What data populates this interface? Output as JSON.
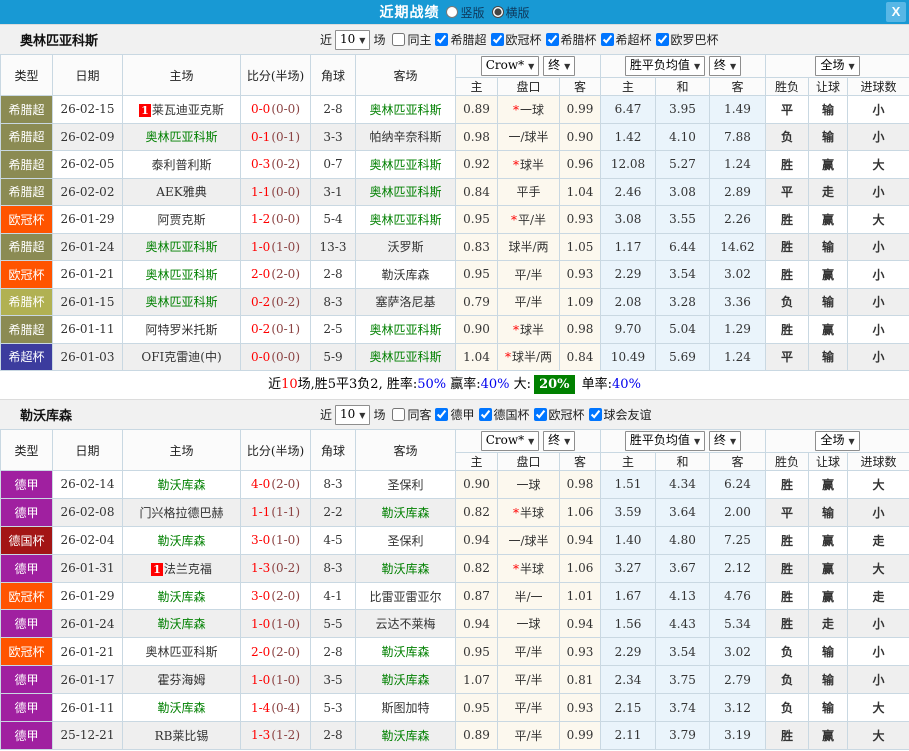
{
  "titlebar": {
    "title": "近期战绩",
    "vertical_label": "竖版",
    "horizontal_label": "横版",
    "selected_layout": "横版",
    "close_label": "X"
  },
  "cols": {
    "type": "类型",
    "date": "日期",
    "home": "主场",
    "score": "比分(半场)",
    "corner": "角球",
    "away": "客场",
    "h": "主",
    "handicap": "盘口",
    "a": "客",
    "avg_h": "主",
    "avg_d": "和",
    "avg_a": "客",
    "result": "胜负",
    "let": "让球",
    "goals": "进球数",
    "sel_crow": "Crow*",
    "sel_final1": "终",
    "sel_avg": "胜平负均值",
    "sel_final2": "终",
    "sel_full": "全场"
  },
  "type_colors": {
    "希腊超": "#8b8b53",
    "欧冠杯": "#ff5400",
    "希腊杯": "#b1b152",
    "希超杯": "#3c3c9e",
    "德甲": "#a020a0",
    "德国杯": "#a31515"
  },
  "accent_colors": {
    "titlebar": "#1899d4",
    "win": "#e60000",
    "loss": "#008000",
    "draw": "#0000e0",
    "summary_highlight": "#008000"
  },
  "sections": [
    {
      "team": "奥林匹亚科斯",
      "near_label": "近",
      "count": "10",
      "matches_label": "场",
      "same_label": "同主",
      "same_checked": false,
      "filters": [
        "希腊超",
        "欧冠杯",
        "希腊杯",
        "希超杯",
        "欧罗巴杯"
      ],
      "rows": [
        {
          "type": "希腊超",
          "date": "26-02-15",
          "badge": "1",
          "home": "莱瓦迪亚克斯",
          "hf": false,
          "ft": "0-0",
          "ht": "(0-0)",
          "corner": "2-8",
          "away": "奥林匹亚科斯",
          "af": true,
          "o1": "0.89",
          "star": true,
          "hcap": "一球",
          "o2": "0.99",
          "m1": "6.47",
          "m2": "3.95",
          "m3": "1.49",
          "res": "平",
          "resc": "b",
          "let": "输",
          "letc": "g",
          "goal": "小",
          "goalc": "g"
        },
        {
          "type": "希腊超",
          "date": "26-02-09",
          "badge": "",
          "home": "奥林匹亚科斯",
          "hf": true,
          "ft": "0-1",
          "ht": "(0-1)",
          "corner": "3-3",
          "away": "帕纳辛奈科斯",
          "af": false,
          "o1": "0.98",
          "star": false,
          "hcap": "一/球半",
          "o2": "0.90",
          "m1": "1.42",
          "m2": "4.10",
          "m3": "7.88",
          "res": "负",
          "resc": "g",
          "let": "输",
          "letc": "g",
          "goal": "小",
          "goalc": "g"
        },
        {
          "type": "希腊超",
          "date": "26-02-05",
          "badge": "",
          "home": "泰利普利斯",
          "hf": false,
          "ft": "0-3",
          "ht": "(0-2)",
          "corner": "0-7",
          "away": "奥林匹亚科斯",
          "af": true,
          "o1": "0.92",
          "star": true,
          "hcap": "球半",
          "o2": "0.96",
          "m1": "12.08",
          "m2": "5.27",
          "m3": "1.24",
          "res": "胜",
          "resc": "r",
          "let": "赢",
          "letc": "r",
          "goal": "大",
          "goalc": "r"
        },
        {
          "type": "希腊超",
          "date": "26-02-02",
          "badge": "",
          "home": "AEK雅典",
          "hf": false,
          "ft": "1-1",
          "ht": "(0-0)",
          "corner": "3-1",
          "away": "奥林匹亚科斯",
          "af": true,
          "o1": "0.84",
          "star": false,
          "hcap": "平手",
          "o2": "1.04",
          "m1": "2.46",
          "m2": "3.08",
          "m3": "2.89",
          "res": "平",
          "resc": "b",
          "let": "走",
          "letc": "b",
          "goal": "小",
          "goalc": "g"
        },
        {
          "type": "欧冠杯",
          "date": "26-01-29",
          "badge": "",
          "home": "阿贾克斯",
          "hf": false,
          "ft": "1-2",
          "ht": "(0-0)",
          "corner": "5-4",
          "away": "奥林匹亚科斯",
          "af": true,
          "o1": "0.95",
          "star": true,
          "hcap": "平/半",
          "o2": "0.93",
          "m1": "3.08",
          "m2": "3.55",
          "m3": "2.26",
          "res": "胜",
          "resc": "r",
          "let": "赢",
          "letc": "r",
          "goal": "大",
          "goalc": "r"
        },
        {
          "type": "希腊超",
          "date": "26-01-24",
          "badge": "",
          "home": "奥林匹亚科斯",
          "hf": true,
          "ft": "1-0",
          "ht": "(1-0)",
          "corner": "13-3",
          "away": "沃罗斯",
          "af": false,
          "o1": "0.83",
          "star": false,
          "hcap": "球半/两",
          "o2": "1.05",
          "m1": "1.17",
          "m2": "6.44",
          "m3": "14.62",
          "res": "胜",
          "resc": "r",
          "let": "输",
          "letc": "g",
          "goal": "小",
          "goalc": "g"
        },
        {
          "type": "欧冠杯",
          "date": "26-01-21",
          "badge": "",
          "home": "奥林匹亚科斯",
          "hf": true,
          "ft": "2-0",
          "ht": "(2-0)",
          "corner": "2-8",
          "away": "勒沃库森",
          "af": false,
          "o1": "0.95",
          "star": false,
          "hcap": "平/半",
          "o2": "0.93",
          "m1": "2.29",
          "m2": "3.54",
          "m3": "3.02",
          "res": "胜",
          "resc": "r",
          "let": "赢",
          "letc": "r",
          "goal": "小",
          "goalc": "g"
        },
        {
          "type": "希腊杯",
          "date": "26-01-15",
          "badge": "",
          "home": "奥林匹亚科斯",
          "hf": true,
          "ft": "0-2",
          "ht": "(0-2)",
          "corner": "8-3",
          "away": "塞萨洛尼基",
          "af": false,
          "o1": "0.79",
          "star": false,
          "hcap": "平/半",
          "o2": "1.09",
          "m1": "2.08",
          "m2": "3.28",
          "m3": "3.36",
          "res": "负",
          "resc": "g",
          "let": "输",
          "letc": "g",
          "goal": "小",
          "goalc": "g"
        },
        {
          "type": "希腊超",
          "date": "26-01-11",
          "badge": "",
          "home": "阿特罗米托斯",
          "hf": false,
          "ft": "0-2",
          "ht": "(0-1)",
          "corner": "2-5",
          "away": "奥林匹亚科斯",
          "af": true,
          "o1": "0.90",
          "star": true,
          "hcap": "球半",
          "o2": "0.98",
          "m1": "9.70",
          "m2": "5.04",
          "m3": "1.29",
          "res": "胜",
          "resc": "r",
          "let": "赢",
          "letc": "r",
          "goal": "小",
          "goalc": "g"
        },
        {
          "type": "希超杯",
          "date": "26-01-03",
          "badge": "",
          "home": "OFI克雷迪(中)",
          "hf": false,
          "ft": "0-0",
          "ht": "(0-0)",
          "corner": "5-9",
          "away": "奥林匹亚科斯",
          "af": true,
          "o1": "1.04",
          "star": true,
          "hcap": "球半/两",
          "o2": "0.84",
          "m1": "10.49",
          "m2": "5.69",
          "m3": "1.24",
          "res": "平",
          "resc": "b",
          "let": "输",
          "letc": "g",
          "goal": "小",
          "goalc": "g"
        }
      ],
      "summary": [
        {
          "t": "近",
          "c": "k"
        },
        {
          "t": "10",
          "c": "r"
        },
        {
          "t": "场,胜5平3负2, 胜率:",
          "c": "k"
        },
        {
          "t": "50%",
          "c": "b"
        },
        {
          "t": " 赢率:",
          "c": "k"
        },
        {
          "t": "40%",
          "c": "b"
        },
        {
          "t": " 大:",
          "c": "k"
        },
        {
          "t": "20%",
          "c": "gbg"
        },
        {
          "t": " 单率:",
          "c": "k"
        },
        {
          "t": "40%",
          "c": "b"
        }
      ]
    },
    {
      "team": "勒沃库森",
      "near_label": "近",
      "count": "10",
      "matches_label": "场",
      "same_label": "同客",
      "same_checked": false,
      "filters": [
        "德甲",
        "德国杯",
        "欧冠杯",
        "球会友谊"
      ],
      "rows": [
        {
          "type": "德甲",
          "date": "26-02-14",
          "badge": "",
          "home": "勒沃库森",
          "hf": true,
          "ft": "4-0",
          "ht": "(2-0)",
          "corner": "8-3",
          "away": "圣保利",
          "af": false,
          "o1": "0.90",
          "star": false,
          "hcap": "一球",
          "o2": "0.98",
          "m1": "1.51",
          "m2": "4.34",
          "m3": "6.24",
          "res": "胜",
          "resc": "r",
          "let": "赢",
          "letc": "r",
          "goal": "大",
          "goalc": "r"
        },
        {
          "type": "德甲",
          "date": "26-02-08",
          "badge": "",
          "home": "门兴格拉德巴赫",
          "hf": false,
          "ft": "1-1",
          "ht": "(1-1)",
          "corner": "2-2",
          "away": "勒沃库森",
          "af": true,
          "o1": "0.82",
          "star": true,
          "hcap": "半球",
          "o2": "1.06",
          "m1": "3.59",
          "m2": "3.64",
          "m3": "2.00",
          "res": "平",
          "resc": "b",
          "let": "输",
          "letc": "g",
          "goal": "小",
          "goalc": "g"
        },
        {
          "type": "德国杯",
          "date": "26-02-04",
          "badge": "",
          "home": "勒沃库森",
          "hf": true,
          "ft": "3-0",
          "ht": "(1-0)",
          "corner": "4-5",
          "away": "圣保利",
          "af": false,
          "o1": "0.94",
          "star": false,
          "hcap": "一/球半",
          "o2": "0.94",
          "m1": "1.40",
          "m2": "4.80",
          "m3": "7.25",
          "res": "胜",
          "resc": "r",
          "let": "赢",
          "letc": "r",
          "goal": "走",
          "goalc": "b"
        },
        {
          "type": "德甲",
          "date": "26-01-31",
          "badge": "1",
          "home": "法兰克福",
          "hf": false,
          "ft": "1-3",
          "ht": "(0-2)",
          "corner": "8-3",
          "away": "勒沃库森",
          "af": true,
          "o1": "0.82",
          "star": true,
          "hcap": "半球",
          "o2": "1.06",
          "m1": "3.27",
          "m2": "3.67",
          "m3": "2.12",
          "res": "胜",
          "resc": "r",
          "let": "赢",
          "letc": "r",
          "goal": "大",
          "goalc": "r"
        },
        {
          "type": "欧冠杯",
          "date": "26-01-29",
          "badge": "",
          "home": "勒沃库森",
          "hf": true,
          "ft": "3-0",
          "ht": "(2-0)",
          "corner": "4-1",
          "away": "比雷亚雷亚尔",
          "af": false,
          "o1": "0.87",
          "star": false,
          "hcap": "半/一",
          "o2": "1.01",
          "m1": "1.67",
          "m2": "4.13",
          "m3": "4.76",
          "res": "胜",
          "resc": "r",
          "let": "赢",
          "letc": "r",
          "goal": "走",
          "goalc": "b"
        },
        {
          "type": "德甲",
          "date": "26-01-24",
          "badge": "",
          "home": "勒沃库森",
          "hf": true,
          "ft": "1-0",
          "ht": "(1-0)",
          "corner": "5-5",
          "away": "云达不莱梅",
          "af": false,
          "o1": "0.94",
          "star": false,
          "hcap": "一球",
          "o2": "0.94",
          "m1": "1.56",
          "m2": "4.43",
          "m3": "5.34",
          "res": "胜",
          "resc": "r",
          "let": "走",
          "letc": "b",
          "goal": "小",
          "goalc": "g"
        },
        {
          "type": "欧冠杯",
          "date": "26-01-21",
          "badge": "",
          "home": "奥林匹亚科斯",
          "hf": false,
          "ft": "2-0",
          "ht": "(2-0)",
          "corner": "2-8",
          "away": "勒沃库森",
          "af": true,
          "o1": "0.95",
          "star": false,
          "hcap": "平/半",
          "o2": "0.93",
          "m1": "2.29",
          "m2": "3.54",
          "m3": "3.02",
          "res": "负",
          "resc": "g",
          "let": "输",
          "letc": "g",
          "goal": "小",
          "goalc": "g"
        },
        {
          "type": "德甲",
          "date": "26-01-17",
          "badge": "",
          "home": "霍芬海姆",
          "hf": false,
          "ft": "1-0",
          "ht": "(1-0)",
          "corner": "3-5",
          "away": "勒沃库森",
          "af": true,
          "o1": "1.07",
          "star": false,
          "hcap": "平/半",
          "o2": "0.81",
          "m1": "2.34",
          "m2": "3.75",
          "m3": "2.79",
          "res": "负",
          "resc": "g",
          "let": "输",
          "letc": "g",
          "goal": "小",
          "goalc": "g"
        },
        {
          "type": "德甲",
          "date": "26-01-11",
          "badge": "",
          "home": "勒沃库森",
          "hf": true,
          "ft": "1-4",
          "ht": "(0-4)",
          "corner": "5-3",
          "away": "斯图加特",
          "af": false,
          "o1": "0.95",
          "star": false,
          "hcap": "平/半",
          "o2": "0.93",
          "m1": "2.15",
          "m2": "3.74",
          "m3": "3.12",
          "res": "负",
          "resc": "g",
          "let": "输",
          "letc": "g",
          "goal": "大",
          "goalc": "r"
        },
        {
          "type": "德甲",
          "date": "25-12-21",
          "badge": "",
          "home": "RB莱比锡",
          "hf": false,
          "ft": "1-3",
          "ht": "(1-2)",
          "corner": "2-8",
          "away": "勒沃库森",
          "af": true,
          "o1": "0.89",
          "star": false,
          "hcap": "平/半",
          "o2": "0.99",
          "m1": "2.11",
          "m2": "3.79",
          "m3": "3.19",
          "res": "胜",
          "resc": "r",
          "let": "赢",
          "letc": "r",
          "goal": "大",
          "goalc": "r"
        }
      ],
      "summary": null
    }
  ]
}
